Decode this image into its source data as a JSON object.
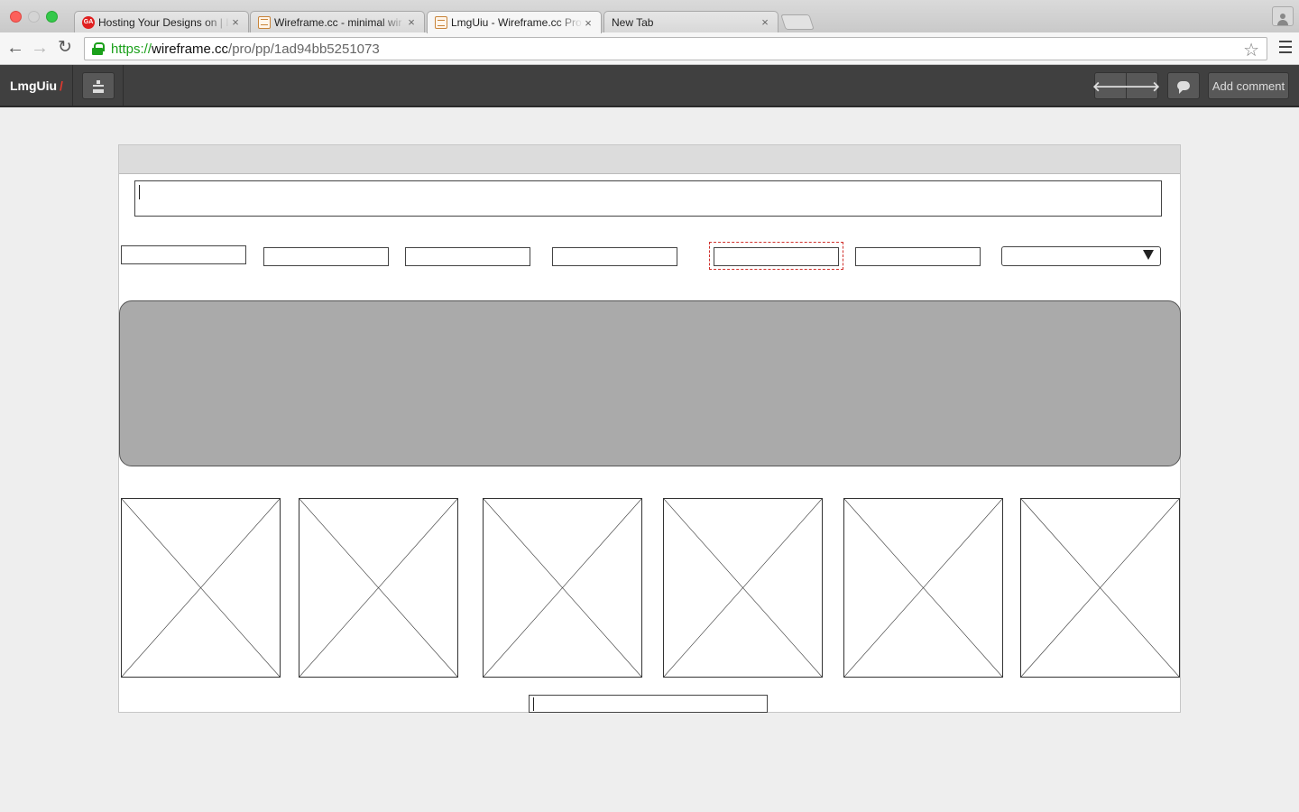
{
  "browser": {
    "tabs": [
      {
        "title": "Hosting Your Designs on | I",
        "favicon": "ga-favicon"
      },
      {
        "title": "Wireframe.cc - minimal wir",
        "favicon": "wireframe-favicon"
      },
      {
        "title": "LmgUiu - Wireframe.cc Pro",
        "favicon": "wireframe-favicon"
      },
      {
        "title": "New Tab",
        "favicon": ""
      }
    ],
    "active_tab": 2,
    "close_glyph": "×",
    "url": {
      "scheme": "https://",
      "host": "wireframe.cc",
      "path": "/pro/pp/1ad94bb5251073"
    },
    "icons": {
      "back": "←",
      "forward": "→",
      "reload": "↻",
      "star": "☆"
    }
  },
  "app": {
    "project_name": "LmgUiu",
    "slash": "/",
    "prev_glyph": "🡐",
    "next_glyph": "🡒",
    "add_comment_label": "Add comment"
  },
  "colors": {
    "app_bar": "#404040",
    "selection": "#d0312d",
    "banner": "#aaaaaa",
    "secure": "#1ba01b"
  }
}
